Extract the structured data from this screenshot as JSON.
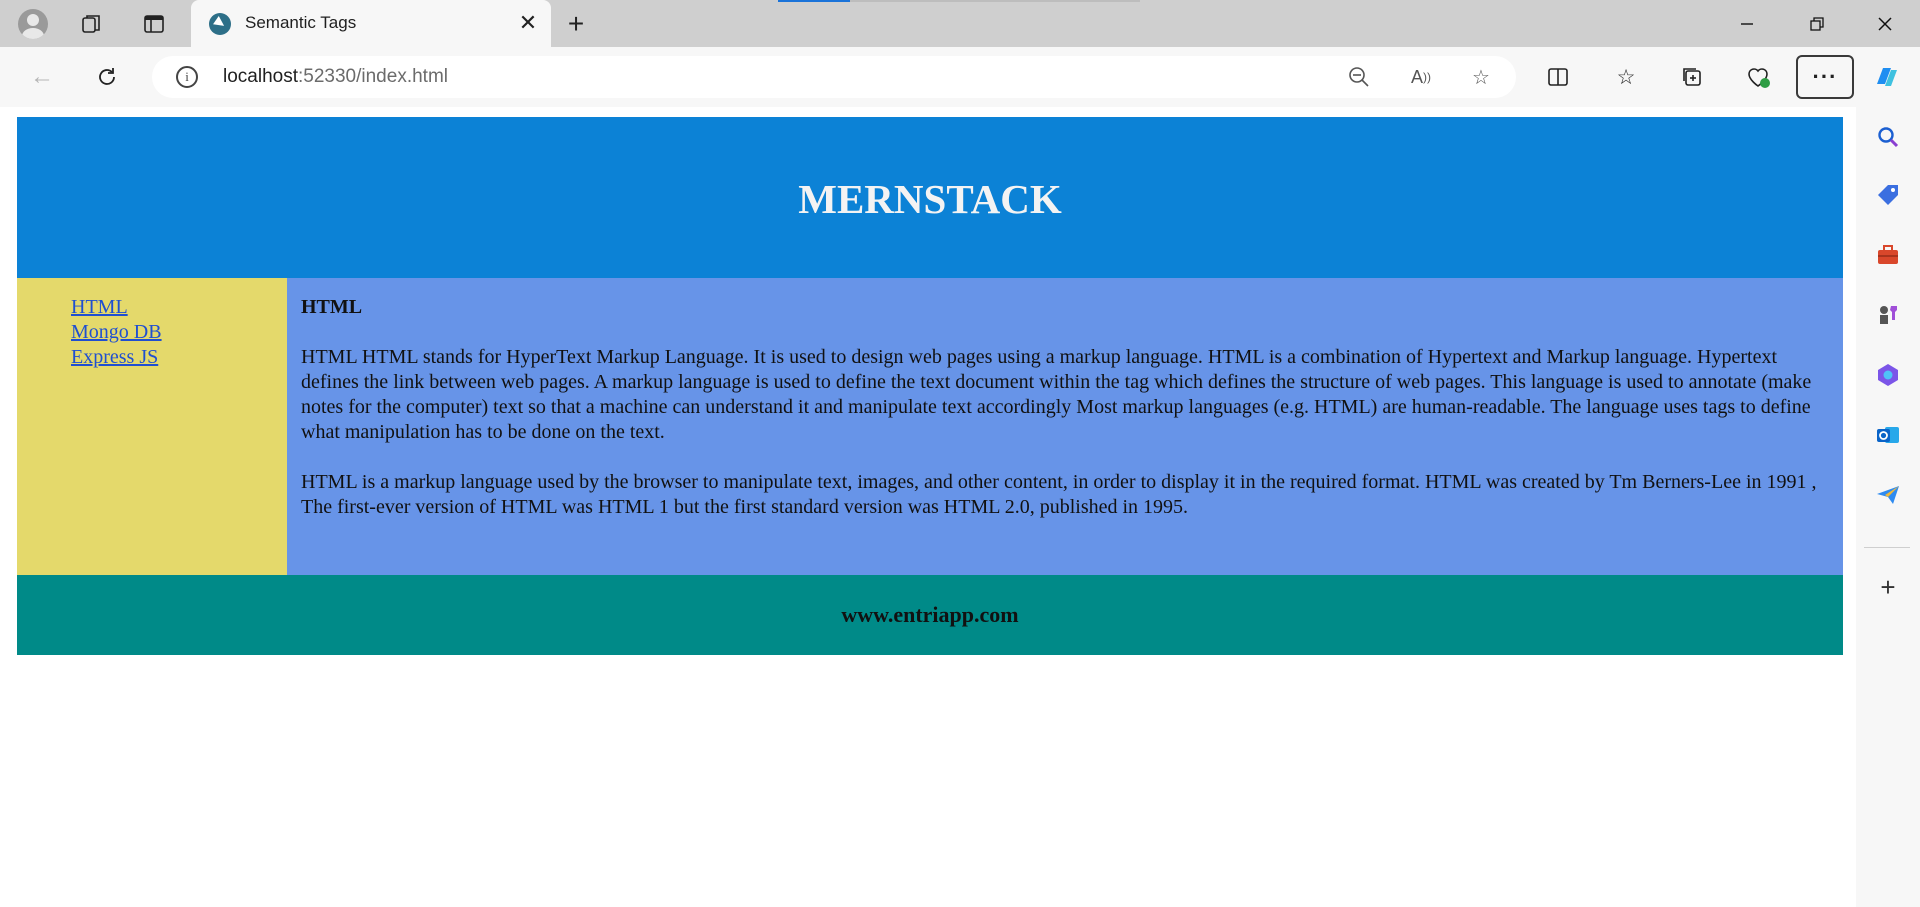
{
  "browser": {
    "tab": {
      "title": "Semantic Tags",
      "favicon": "edge-page-icon"
    },
    "address": {
      "host": "localhost",
      "rest": ":52330/index.html"
    },
    "colors": {
      "accent": "#1a73d9",
      "titlebar": "#cfcfcf"
    }
  },
  "page": {
    "header": {
      "title": "MERNSTACK"
    },
    "nav": {
      "links": [
        {
          "label": "HTML"
        },
        {
          "label": "Mongo DB"
        },
        {
          "label": "Express JS"
        }
      ]
    },
    "main": {
      "heading": "HTML",
      "paragraphs": [
        "HTML HTML stands for HyperText Markup Language. It is used to design web pages using a markup language. HTML is a combination of Hypertext and Markup language. Hypertext defines the link between web pages. A markup language is used to define the text document within the tag which defines the structure of web pages. This language is used to annotate (make notes for the computer) text so that a machine can understand it and manipulate text accordingly Most markup languages (e.g. HTML) are human-readable. The language uses tags to define what manipulation has to be done on the text.",
        "HTML is a markup language used by the browser to manipulate text, images, and other content, in order to display it in the required format. HTML was created by Tm Berners-Lee in 1991 , The first-ever version of HTML was HTML 1 but the first standard version was HTML 2.0, published in 1995."
      ]
    },
    "footer": {
      "text": "www.entriapp.com"
    },
    "colors": {
      "header_bg": "#0c82d6",
      "nav_bg": "#e4d96b",
      "main_bg": "#6794e8",
      "footer_bg": "#008a88"
    }
  }
}
